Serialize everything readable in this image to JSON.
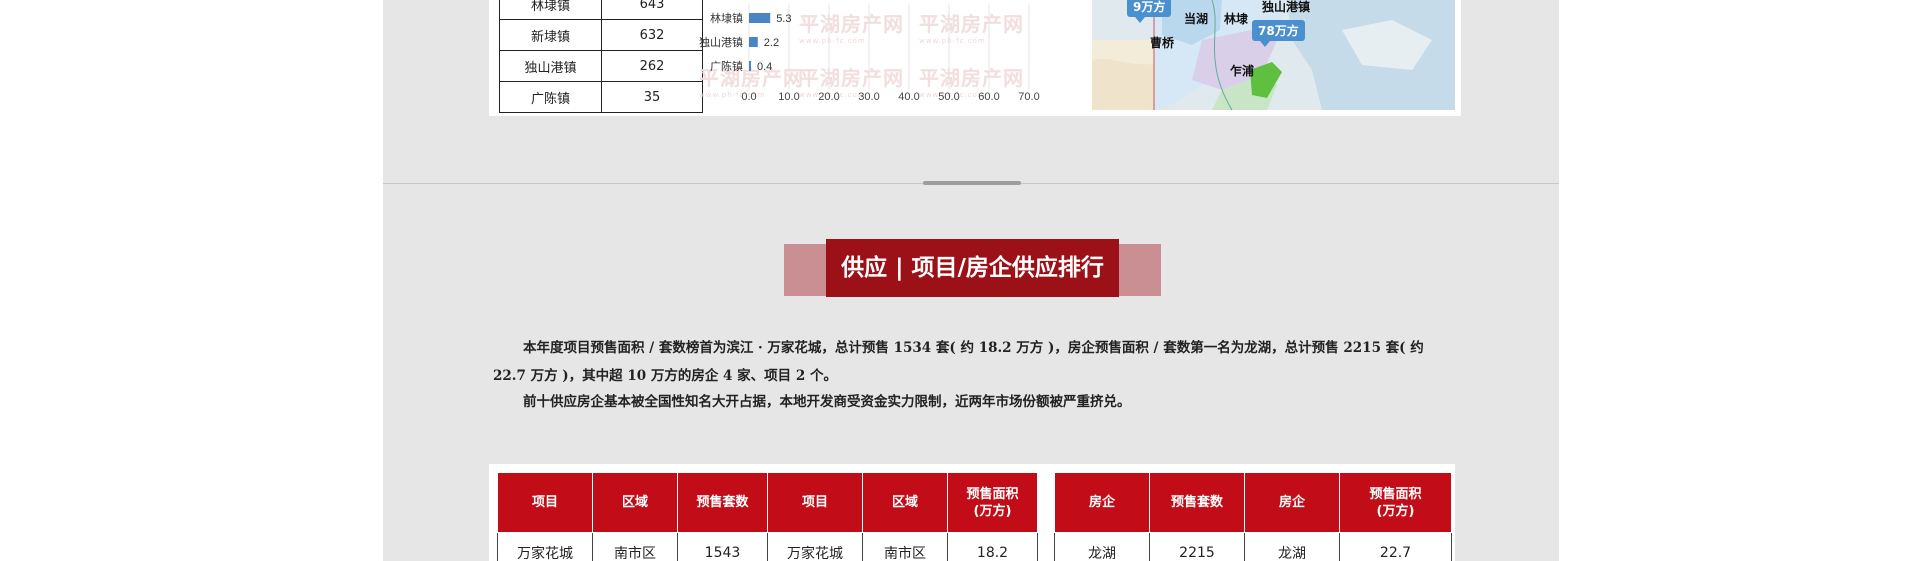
{
  "town_table": [
    {
      "name": "林埭镇",
      "value": "643"
    },
    {
      "name": "新埭镇",
      "value": "632"
    },
    {
      "name": "独山港镇",
      "value": "262"
    },
    {
      "name": "广陈镇",
      "value": "35"
    }
  ],
  "chart_data": {
    "type": "bar",
    "orientation": "horizontal",
    "categories": [
      "林埭镇",
      "独山港镇",
      "广陈镇"
    ],
    "values": [
      5.3,
      2.2,
      0.4
    ],
    "x_ticks": [
      "0.0",
      "10.0",
      "20.0",
      "30.0",
      "40.0",
      "50.0",
      "60.0",
      "70.0"
    ],
    "xlim": [
      0,
      70
    ],
    "grid": true,
    "bar_color": "#4a84c4"
  },
  "watermark": {
    "text": "平湖房产网",
    "sub": "www.ph-fc.com"
  },
  "map": {
    "labels": [
      "当湖",
      "林埭",
      "独山港镇",
      "曹桥",
      "乍浦"
    ],
    "badges": [
      "9万方",
      "78万方"
    ]
  },
  "section_title": "供应 | 项目/房企供应排行",
  "paragraphs": [
    "本年度项目预售面积 / 套数榜首为滨江 · 万家花城，总计预售 1534 套( 约 18.2 万方 )，房企预售面积 / 套数第一名为龙湖，总计预售 2215 套( 约 22.7 万方 )，其中超 10 万方的房企 4 家、项目 2 个。",
    "前十供应房企基本被全国性知名大开占据，本地开发商受资金实力限制，近两年市场份额被严重挤兑。"
  ],
  "project_table": {
    "headers": [
      "项目",
      "区域",
      "预售套数",
      "项目",
      "区域",
      "预售面积\n(万方)"
    ],
    "rows": [
      [
        "万家花城",
        "南市区",
        "1543",
        "万家花城",
        "南市区",
        "18.2"
      ]
    ]
  },
  "developer_table": {
    "headers": [
      "房企",
      "预售套数",
      "房企",
      "预售面积\n(万方)"
    ],
    "rows": [
      [
        "龙湖",
        "2215",
        "龙湖",
        "22.7"
      ]
    ]
  },
  "colors": {
    "header_red": "#c20d18",
    "heading_red": "#9c1017",
    "heading_pink": "#c98f93"
  }
}
